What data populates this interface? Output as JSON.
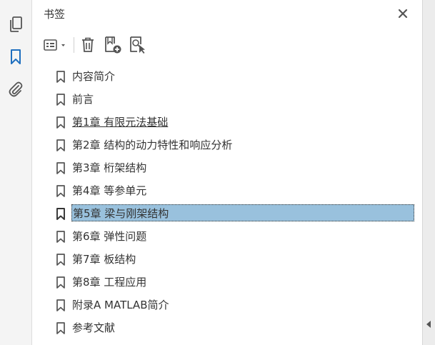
{
  "rail": {
    "items": [
      {
        "name": "pages-thumbnails",
        "icon": "pages-icon",
        "active": false
      },
      {
        "name": "bookmarks",
        "icon": "bookmark-icon",
        "active": true
      },
      {
        "name": "attachments",
        "icon": "paperclip-icon",
        "active": false
      }
    ]
  },
  "panel": {
    "title": "书签",
    "close_icon": "close-icon"
  },
  "toolbar": {
    "options_icon": "list-options-icon",
    "delete_icon": "trash-icon",
    "new_bookmark_icon": "new-bookmark-icon",
    "find_bookmark_icon": "find-current-bookmark-icon"
  },
  "bookmarks": {
    "items": [
      {
        "label": "内容简介"
      },
      {
        "label": "前言"
      },
      {
        "label": "第1章 有限元法基础",
        "underlined": true
      },
      {
        "label": "第2章 结构的动力特性和响应分析"
      },
      {
        "label": "第3章 桁架结构"
      },
      {
        "label": "第4章 等参单元"
      },
      {
        "label": "第5章 梁与刚架结构",
        "selected": true
      },
      {
        "label": "第6章 弹性问题"
      },
      {
        "label": "第7章 板结构"
      },
      {
        "label": "第8章 工程应用"
      },
      {
        "label": "附录A MATLAB简介"
      },
      {
        "label": "参考文献"
      }
    ]
  },
  "colors": {
    "accent": "#1f6fbf",
    "selection": "#99c1dd",
    "icon": "#555555",
    "text": "#333333"
  }
}
